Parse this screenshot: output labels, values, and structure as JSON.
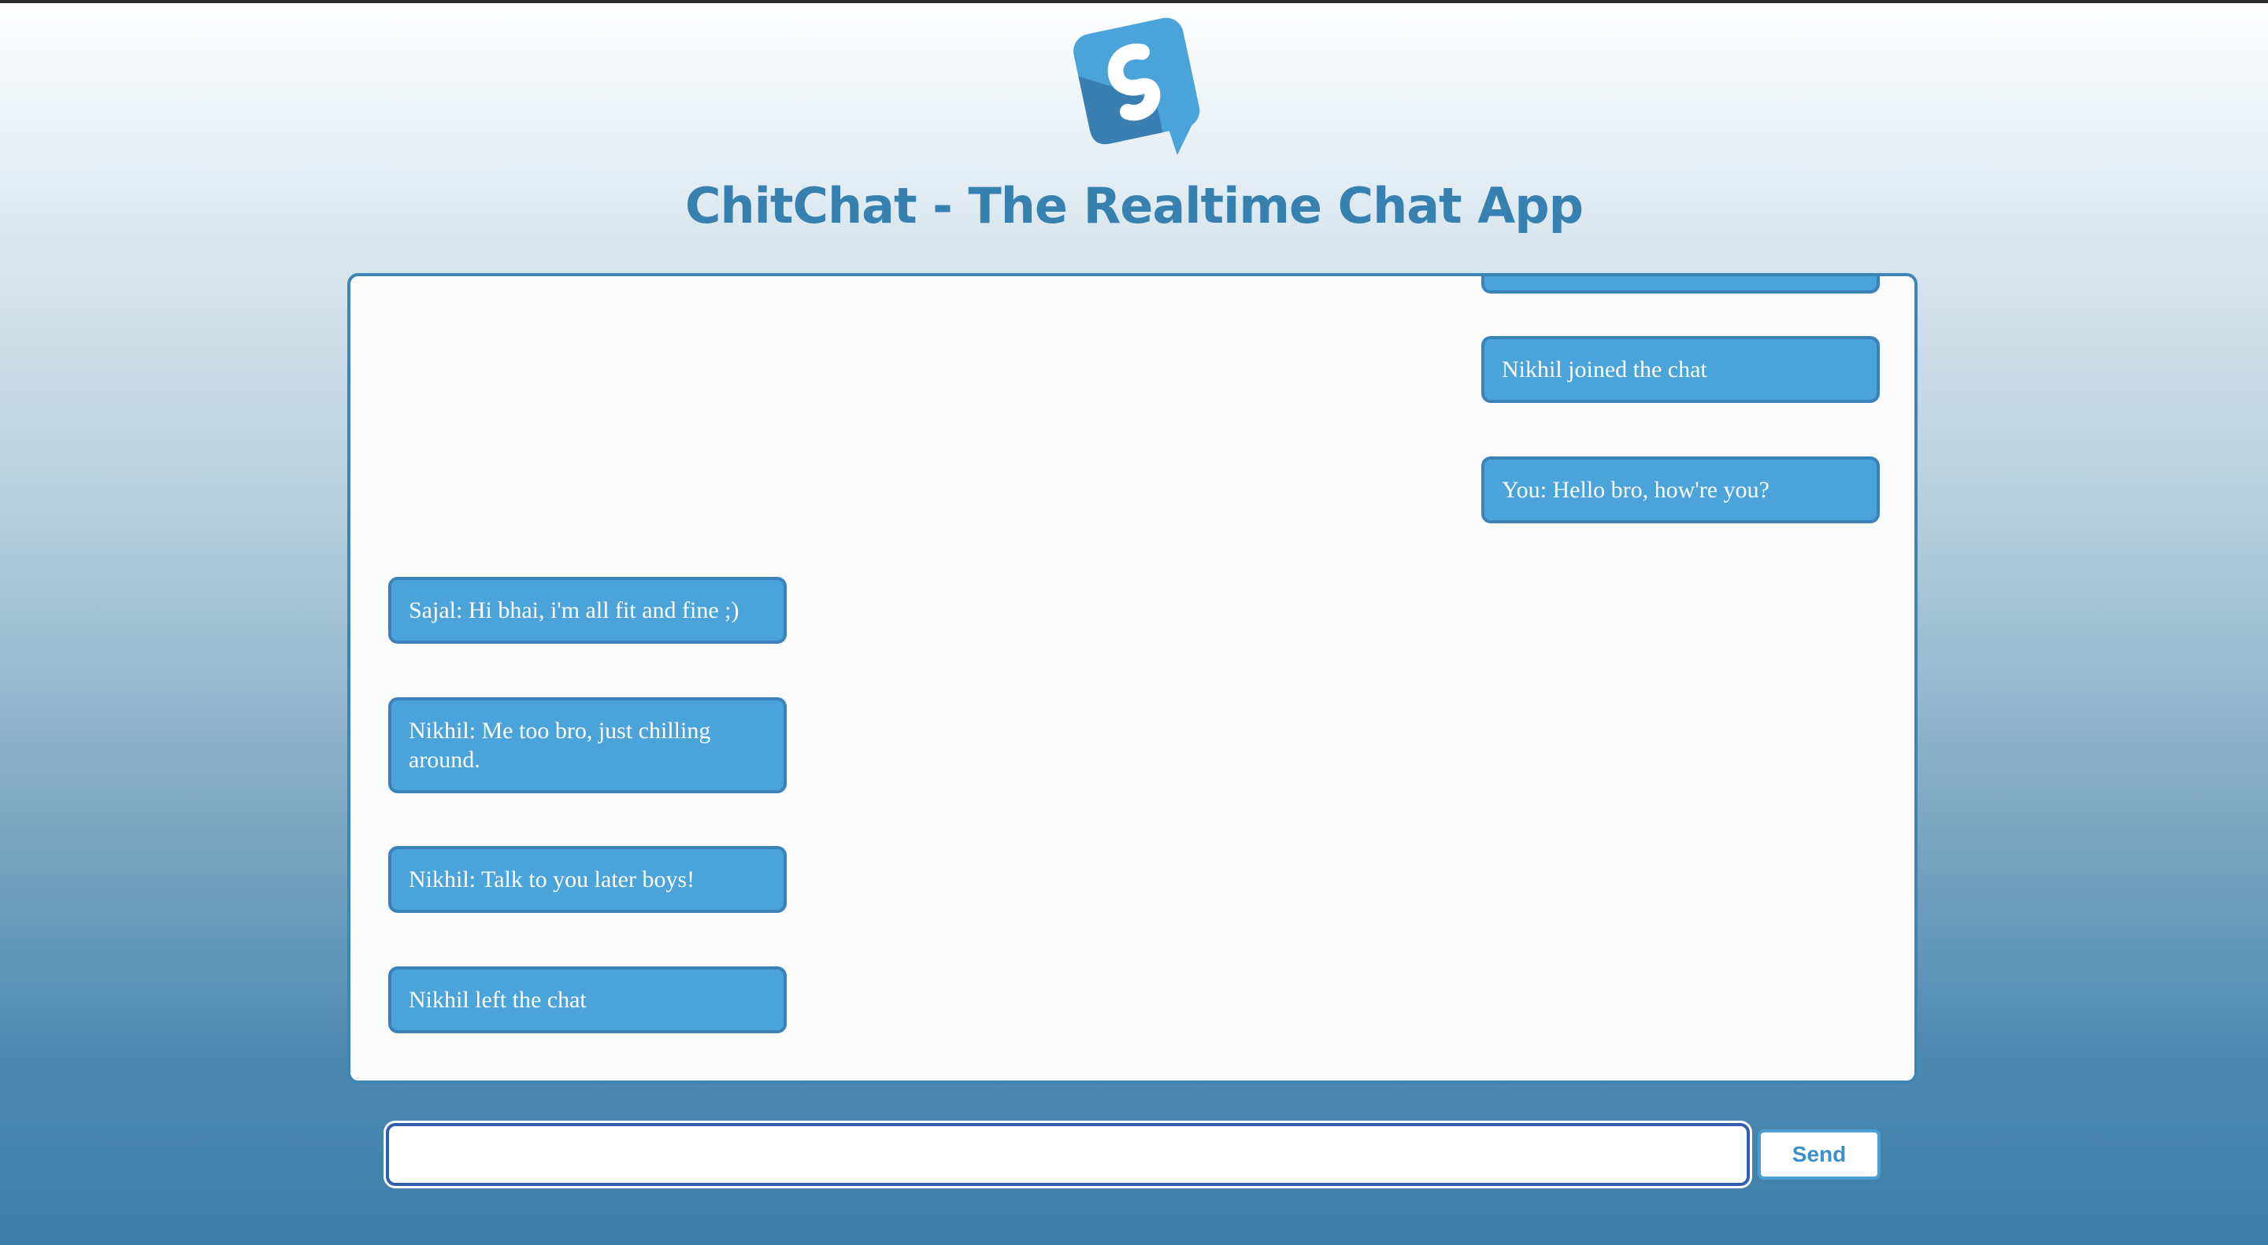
{
  "app": {
    "title": "ChitChat - The Realtime Chat App",
    "logo_icon": "chitchat-logo-icon"
  },
  "colors": {
    "accent": "#3781b0",
    "bubble": "#4aa3d9",
    "bubble_border": "#3a82b8"
  },
  "messages": [
    {
      "side": "right",
      "text": ""
    },
    {
      "side": "right",
      "text": "Nikhil joined the chat"
    },
    {
      "side": "right",
      "text": "You: Hello bro, how're you?"
    },
    {
      "side": "left",
      "text": "Sajal: Hi bhai, i'm all fit and fine ;)"
    },
    {
      "side": "left",
      "text": "Nikhil: Me too bro, just chilling around."
    },
    {
      "side": "left",
      "text": "Nikhil: Talk to you later boys!"
    },
    {
      "side": "left",
      "text": "Nikhil left the chat"
    }
  ],
  "composer": {
    "value": "",
    "placeholder": "",
    "send_label": "Send"
  }
}
